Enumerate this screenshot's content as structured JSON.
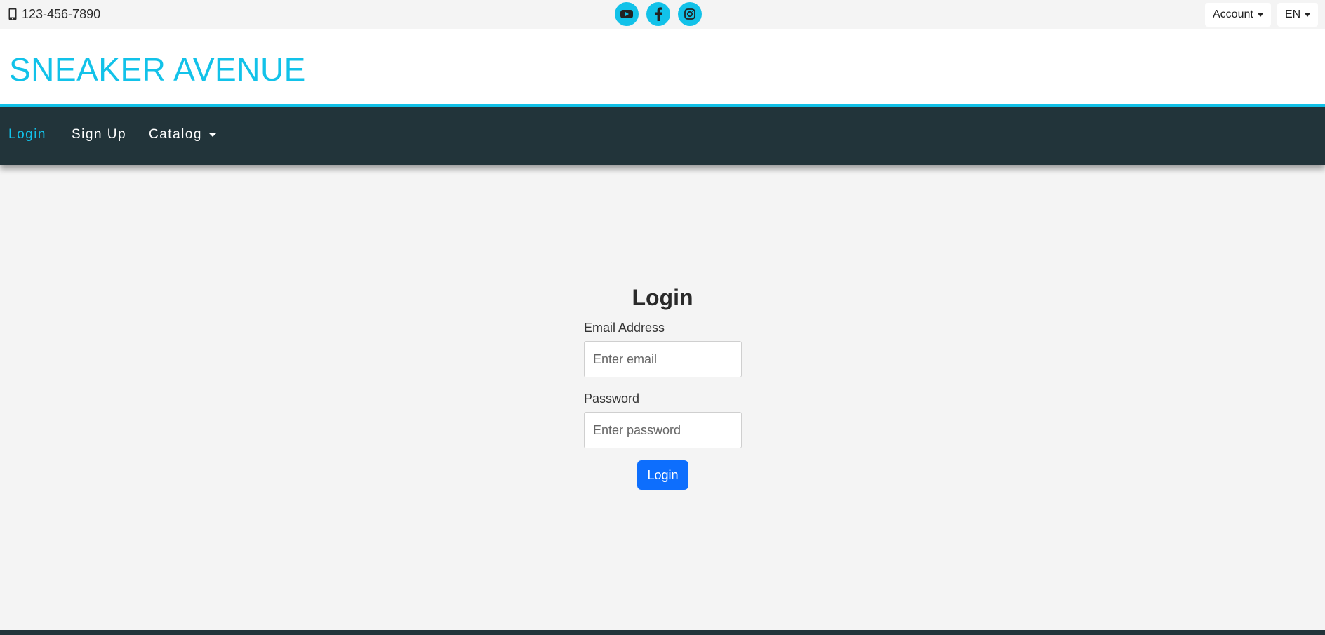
{
  "topbar": {
    "phone": "123-456-7890",
    "phone_icon": "mobile-phone-icon",
    "socials": [
      "youtube-icon",
      "facebook-icon",
      "instagram-icon"
    ],
    "account_label": "Account",
    "language_label": "EN"
  },
  "header": {
    "brand": "SNEAKER AVENUE"
  },
  "nav": {
    "items": [
      {
        "label": "Login",
        "active": true
      },
      {
        "label": "Sign Up",
        "active": false
      },
      {
        "label": "Catalog",
        "active": false
      }
    ]
  },
  "login": {
    "title": "Login",
    "email_label": "Email Address",
    "email_placeholder": "Enter email",
    "password_label": "Password",
    "password_placeholder": "Enter password",
    "submit_label": "Login"
  },
  "colors": {
    "accent": "#12c2e9",
    "nav_bg": "#22343a",
    "primary_button": "#0d6efd",
    "page_bg": "#f4f4f4"
  }
}
